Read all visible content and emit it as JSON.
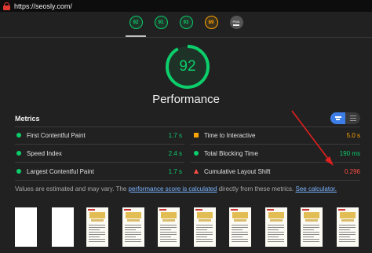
{
  "urlbar": {
    "url": "https://seosly.com/"
  },
  "top_gauges": [
    {
      "score": "92",
      "category": "performance",
      "color": "#0cce6b",
      "active": true
    },
    {
      "score": "91",
      "category": "accessibility",
      "color": "#0cce6b"
    },
    {
      "score": "93",
      "category": "best-practices",
      "color": "#0cce6b"
    },
    {
      "score": "89",
      "category": "seo",
      "color": "#ffa400"
    },
    {
      "score": "PWA",
      "category": "pwa",
      "color": "#555555"
    }
  ],
  "main_gauge": {
    "score": "92",
    "fraction": 0.92,
    "color": "#0cce6b"
  },
  "performance_title": "Performance",
  "metrics": {
    "heading": "Metrics",
    "items": [
      {
        "label": "First Contentful Paint",
        "value": "1.7 s",
        "status": "good"
      },
      {
        "label": "Time to Interactive",
        "value": "5.0 s",
        "status": "average"
      },
      {
        "label": "Speed Index",
        "value": "2.4 s",
        "status": "good"
      },
      {
        "label": "Total Blocking Time",
        "value": "190 ms",
        "status": "good"
      },
      {
        "label": "Largest Contentful Paint",
        "value": "1.7 s",
        "status": "good"
      },
      {
        "label": "Cumulative Layout Shift",
        "value": "0.296",
        "status": "poor"
      }
    ]
  },
  "note": {
    "prefix": "Values are estimated and may vary. The ",
    "link1": "performance score is calculated",
    "middle": " directly from these metrics. ",
    "link2": "See calculator."
  },
  "filmstrip": {
    "frames": [
      "blank",
      "blank",
      "content",
      "content",
      "content",
      "content",
      "content",
      "content",
      "content",
      "content"
    ]
  },
  "colors": {
    "good": "#0cce6b",
    "average": "#ffa400",
    "poor": "#ff4e42",
    "annotation_arrow": "#e02020"
  }
}
